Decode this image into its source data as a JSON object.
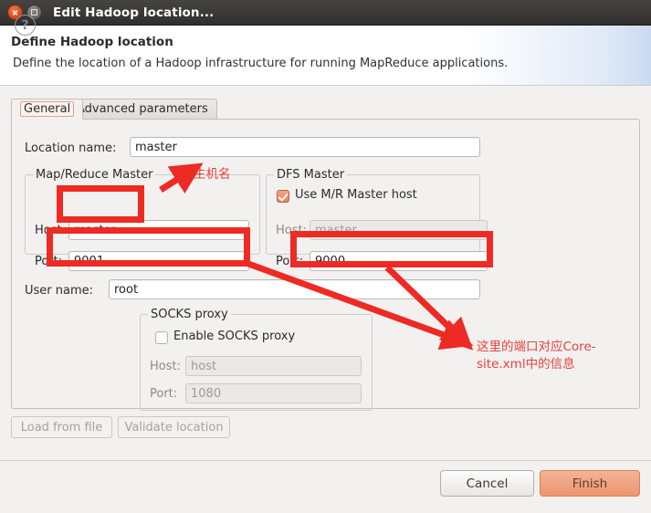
{
  "window": {
    "title": "Edit Hadoop location...",
    "close_icon": "close-icon",
    "maximize_icon": "maximize-icon"
  },
  "header": {
    "title": "Define Hadoop location",
    "description": "Define the location of a Hadoop infrastructure for running MapReduce applications."
  },
  "tabs": [
    {
      "label": "General",
      "selected": true
    },
    {
      "label": "Advanced parameters",
      "selected": false
    }
  ],
  "form": {
    "location_name": {
      "label": "Location name:",
      "value": "master"
    },
    "map_reduce_master": {
      "title": "Map/Reduce Master",
      "host": {
        "label": "Host:",
        "value": "master"
      },
      "port": {
        "label": "Port:",
        "value": "9001"
      }
    },
    "dfs_master": {
      "title": "DFS Master",
      "use_mr_master_host": {
        "label": "Use M/R Master host",
        "checked": true
      },
      "host": {
        "label": "Host:",
        "value": "master",
        "disabled": true
      },
      "port": {
        "label": "Port:",
        "value": "9000"
      }
    },
    "user_name": {
      "label": "User name:",
      "value": "root"
    },
    "socks_proxy": {
      "title": "SOCKS proxy",
      "enable": {
        "label": "Enable SOCKS proxy",
        "checked": false
      },
      "host": {
        "label": "Host:",
        "value": "host",
        "disabled": true
      },
      "port": {
        "label": "Port:",
        "value": "1080",
        "disabled": true
      }
    }
  },
  "actions": {
    "load_from_file": "Load from file",
    "validate_location": "Validate location",
    "help_icon": "?",
    "cancel": "Cancel",
    "finish": "Finish"
  },
  "annotations": {
    "hostname_note": "主机名",
    "port_note": "这里的端口对应Core-site.xml中的信息",
    "color": "#ee2a24"
  }
}
